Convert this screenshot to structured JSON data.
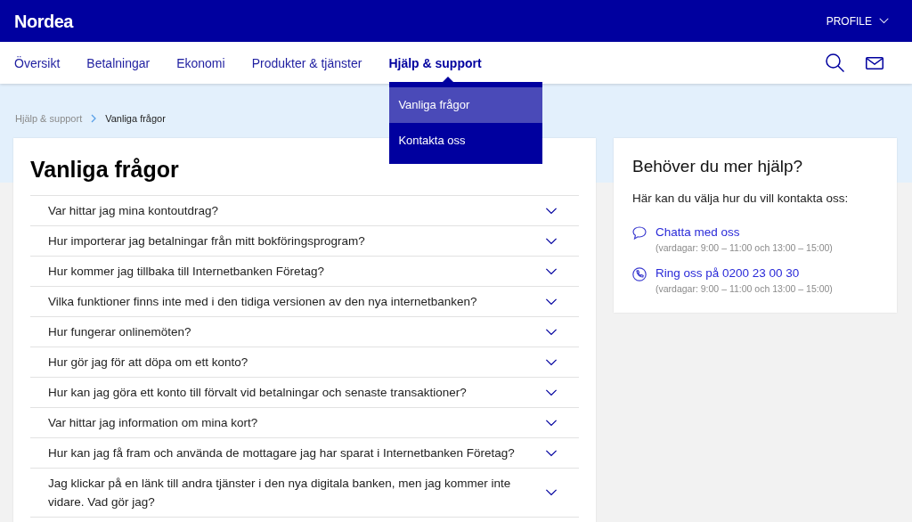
{
  "header": {
    "logo": "Nordea",
    "profile": "PROFILE"
  },
  "nav": [
    {
      "label": "Översikt",
      "selected": false
    },
    {
      "label": "Betalningar",
      "selected": false
    },
    {
      "label": "Ekonomi",
      "selected": false
    },
    {
      "label": "Produkter & tjänster",
      "selected": false
    },
    {
      "label": "Hjälp & support",
      "selected": true
    }
  ],
  "dropdown": [
    {
      "label": "Vanliga frågor",
      "selected": true
    },
    {
      "label": "Kontakta oss",
      "selected": false
    }
  ],
  "breadcrumb": [
    "Hjälp & support",
    "Vanliga frågor"
  ],
  "faq": {
    "title": "Vanliga frågor",
    "items": [
      {
        "question": "Var hittar jag mina kontoutdrag?",
        "expanded": false
      },
      {
        "question": "Hur importerar jag betalningar från mitt bokföringsprogram?",
        "expanded": false
      },
      {
        "question": "Hur kommer jag tillbaka till Internetbanken Företag?",
        "expanded": false
      },
      {
        "question": "Vilka funktioner finns inte med i den tidiga versionen av den nya internetbanken?",
        "expanded": false
      },
      {
        "question": "Hur fungerar onlinemöten?",
        "expanded": false
      },
      {
        "question": "Hur gör jag för att döpa om ett konto?",
        "expanded": false
      },
      {
        "question": "Hur kan jag göra ett konto till förvalt vid betalningar och senaste transaktioner?",
        "expanded": false
      },
      {
        "question": "Var hittar jag information om mina kort?",
        "expanded": false
      },
      {
        "question": "Hur kan jag få fram och använda de mottagare jag har sparat i Internetbanken Företag?",
        "expanded": false
      },
      {
        "question": "Jag klickar på en länk till andra tjänster i den nya digitala banken, men jag kommer inte vidare. Vad gör jag?",
        "expanded": false
      }
    ]
  },
  "help": {
    "title": "Behöver du mer hjälp?",
    "intro": "Här kan du välja hur du vill kontakta oss:",
    "contacts": [
      {
        "kind": "chat",
        "label": "Chatta med oss",
        "hours": "(vardagar: 9:00 – 11:00 och 13:00 – 15:00)"
      },
      {
        "kind": "phone",
        "label": "Ring oss på 0200 23 00 30",
        "hours": "(vardagar: 9:00 – 11:00 och 13:00 – 15:00)"
      }
    ]
  }
}
